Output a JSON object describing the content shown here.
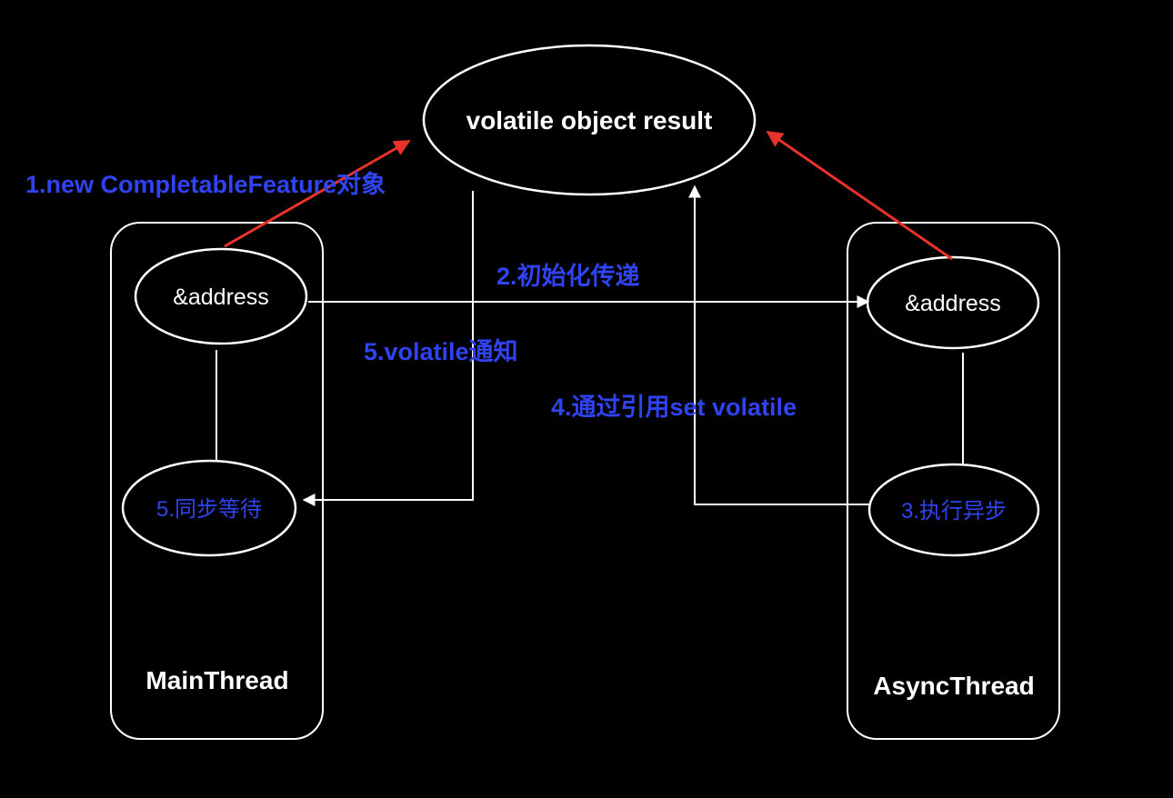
{
  "result": {
    "label": "volatile object result"
  },
  "main_thread": {
    "title": "MainThread",
    "address_label": "&address",
    "wait_label": "5.同步等待"
  },
  "async_thread": {
    "title": "AsyncThread",
    "address_label": "&address",
    "exec_label": "3.执行异步"
  },
  "steps": {
    "step1": "1.new CompletableFeature对象",
    "step2": "2.初始化传递",
    "step4": "4.通过引用set volatile",
    "step5": "5.volatile通知"
  },
  "colors": {
    "background": "#000000",
    "stroke": "#ffffff",
    "label_blue": "#2f44f0",
    "arrow_red": "#e8322a"
  }
}
